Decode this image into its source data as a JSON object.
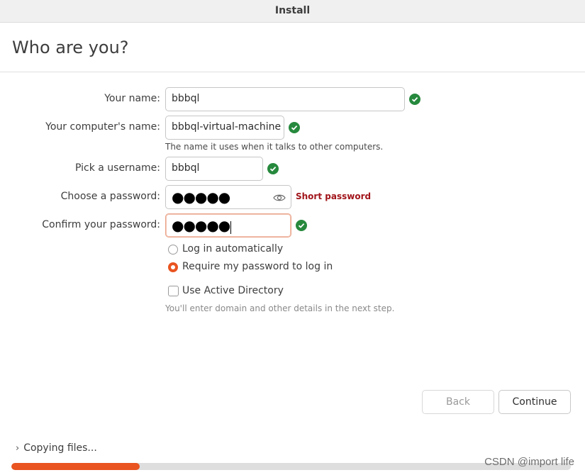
{
  "window": {
    "title": "Install"
  },
  "page": {
    "heading": "Who are you?"
  },
  "form": {
    "name": {
      "label": "Your name:",
      "value": "bbbql",
      "valid": true
    },
    "computer": {
      "label": "Your computer's name:",
      "value": "bbbql-virtual-machine",
      "valid": true,
      "hint": "The name it uses when it talks to other computers."
    },
    "username": {
      "label": "Pick a username:",
      "value": "bbbql",
      "valid": true
    },
    "password": {
      "label": "Choose a password:",
      "masked": "●●●●●",
      "strength": "Short password"
    },
    "confirm": {
      "label": "Confirm your password:",
      "masked": "●●●●●",
      "valid": true
    }
  },
  "login_options": {
    "auto_login": {
      "label": "Log in automatically",
      "selected": false
    },
    "require_password": {
      "label": "Require my password to log in",
      "selected": true
    }
  },
  "active_directory": {
    "label": "Use Active Directory",
    "checked": false,
    "hint": "You'll enter domain and other details in the next step."
  },
  "buttons": {
    "back": "Back",
    "continue": "Continue"
  },
  "status": {
    "text": "Copying files...",
    "progress": 0.23
  },
  "colors": {
    "accent": "#e95420",
    "valid": "#26893d",
    "warning": "#a1151b"
  },
  "watermark": "CSDN @import life"
}
